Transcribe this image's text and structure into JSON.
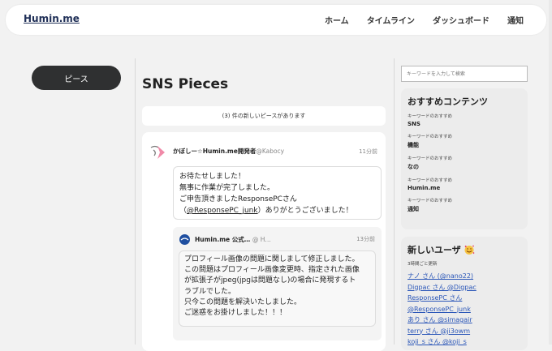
{
  "header": {
    "brand": "Humin.me",
    "nav": [
      "ホーム",
      "タイムライン",
      "ダッシュボード",
      "通知"
    ]
  },
  "sidebar": {
    "pieces_button": "ピース"
  },
  "main": {
    "title": "SNS Pieces",
    "new_pieces": "(3) 件の新しいピースがあります",
    "post": {
      "user": "かぼしー☆Humin.me開発者",
      "handle": "@Kabocy",
      "time": "11分前",
      "lines": [
        "お待たせしました！",
        "無事に作業が完了しました。",
        "ご申告頂きましたResponsePCさん"
      ],
      "line4_before": "（",
      "line4_mention": "@ResponsePC_junk",
      "line4_after": "）ありがとうございました！"
    },
    "reply": {
      "user": "Humin.me 公式…",
      "handle": "@ H…",
      "time": "13分前",
      "lines": [
        "プロフィール画像の問題に関しまして修正しました。",
        "この問題はプロフィール画像変更時、指定された画像",
        "が拡張子がjpeg(jpgは問題なし)の場合に発現するト",
        "ラブルでした。",
        "只今この問題を解決いたしました。",
        "ご迷惑をお掛けしました！！！"
      ]
    }
  },
  "right": {
    "search_placeholder": "キーワードを入力して検索",
    "reco_title": "おすすめコンテンツ",
    "reco_caption": "キーワードのおすすめ",
    "reco_keywords": [
      "SNS",
      "機能",
      "なの",
      "Humin.me",
      "通知"
    ],
    "users_title": "新しいユーザ",
    "users_sub": "3時間ごと更新",
    "users": [
      "ナノ さん (@nano22)",
      "Digpac さん @Digpac",
      "ResponsePC さん",
      "@ResponsePC_junk",
      "あり さん @simagair",
      "terry さん @ji3owm",
      "koji_s さん @koji_s"
    ]
  },
  "colors": {
    "accent_dark": "#2f3031",
    "link": "#2a56b8",
    "brand": "#1f2f57"
  },
  "icons": {
    "post_avatar": "pink-logo-icon",
    "reply_avatar": "humin-logo-icon",
    "users_emoji": "smiling-face-with-hearts-icon"
  }
}
